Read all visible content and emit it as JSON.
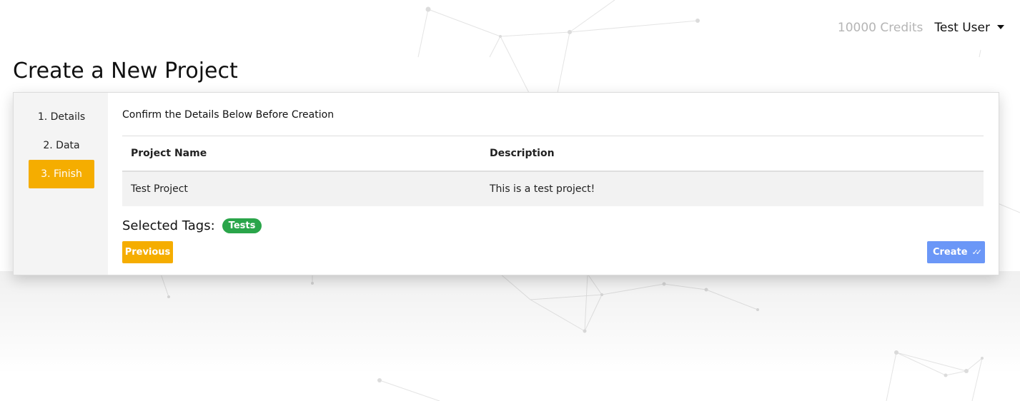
{
  "header": {
    "credits": "10000 Credits",
    "user_name": "Test User"
  },
  "page": {
    "title": "Create a New Project"
  },
  "steps": [
    {
      "label": "1. Details",
      "active": false
    },
    {
      "label": "2. Data",
      "active": false
    },
    {
      "label": "3. Finish",
      "active": true
    }
  ],
  "confirm": {
    "heading": "Confirm the Details Below Before Creation",
    "columns": [
      "Project Name",
      "Description"
    ],
    "rows": [
      [
        "Test Project",
        "This is a test project!"
      ]
    ],
    "tags_label": "Selected Tags:",
    "tags": [
      "Tests"
    ]
  },
  "buttons": {
    "previous": "Previous",
    "create": "Create"
  },
  "icons": {
    "user_menu": "chevron-down-icon",
    "create": "double-check-icon"
  },
  "colors": {
    "accent": "#f5ad00",
    "primary": "#6b97f7",
    "tag": "#2aa54a"
  }
}
